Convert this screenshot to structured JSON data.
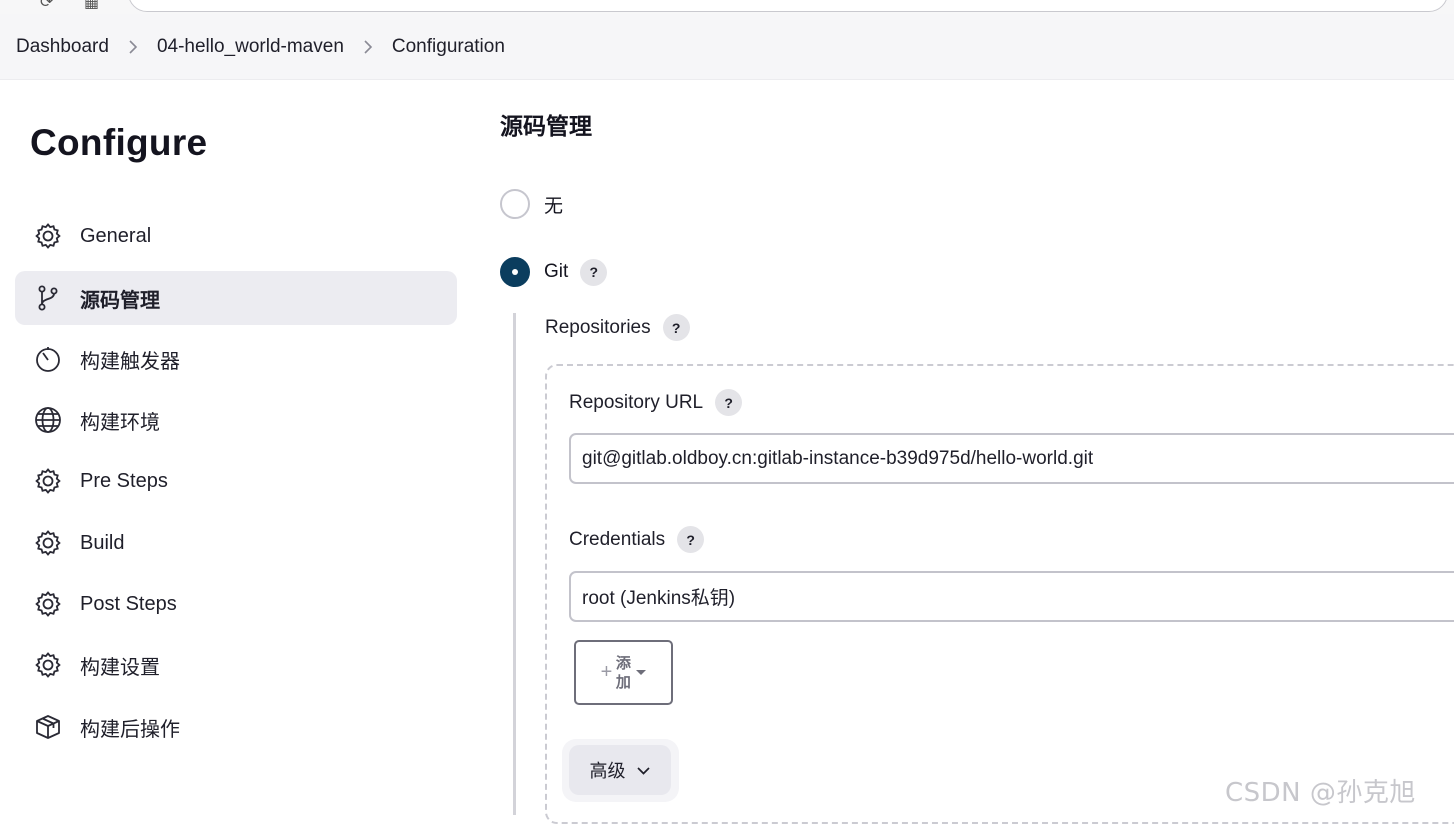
{
  "breadcrumb": {
    "items": [
      "Dashboard",
      "04-hello_world-maven",
      "Configuration"
    ]
  },
  "sidebar": {
    "title": "Configure",
    "items": [
      {
        "label": "General",
        "icon": "gear-icon"
      },
      {
        "label": "源码管理",
        "icon": "branch-icon",
        "active": true
      },
      {
        "label": "构建触发器",
        "icon": "timer-icon"
      },
      {
        "label": "构建环境",
        "icon": "globe-icon"
      },
      {
        "label": "Pre Steps",
        "icon": "gear-icon"
      },
      {
        "label": "Build",
        "icon": "gear-icon"
      },
      {
        "label": "Post Steps",
        "icon": "gear-icon"
      },
      {
        "label": "构建设置",
        "icon": "gear-icon"
      },
      {
        "label": "构建后操作",
        "icon": "package-icon"
      }
    ]
  },
  "scm": {
    "title": "源码管理",
    "option_none": "无",
    "option_git": "Git",
    "help_glyph": "?",
    "repositories_label": "Repositories",
    "repository_url_label": "Repository URL",
    "repository_url_value": "git@gitlab.oldboy.cn:gitlab-instance-b39d975d/hello-world.git",
    "credentials_label": "Credentials",
    "credentials_value": "root (Jenkins私钥)",
    "add_plus": "+",
    "add_label": "添加",
    "advanced_label": "高级"
  },
  "watermark": "CSDN @孙克旭",
  "colors": {
    "radio_checked": "#0b3d5e",
    "sidebar_active_bg": "#ececf1",
    "breadcrumb_bg": "#f6f6f8"
  }
}
